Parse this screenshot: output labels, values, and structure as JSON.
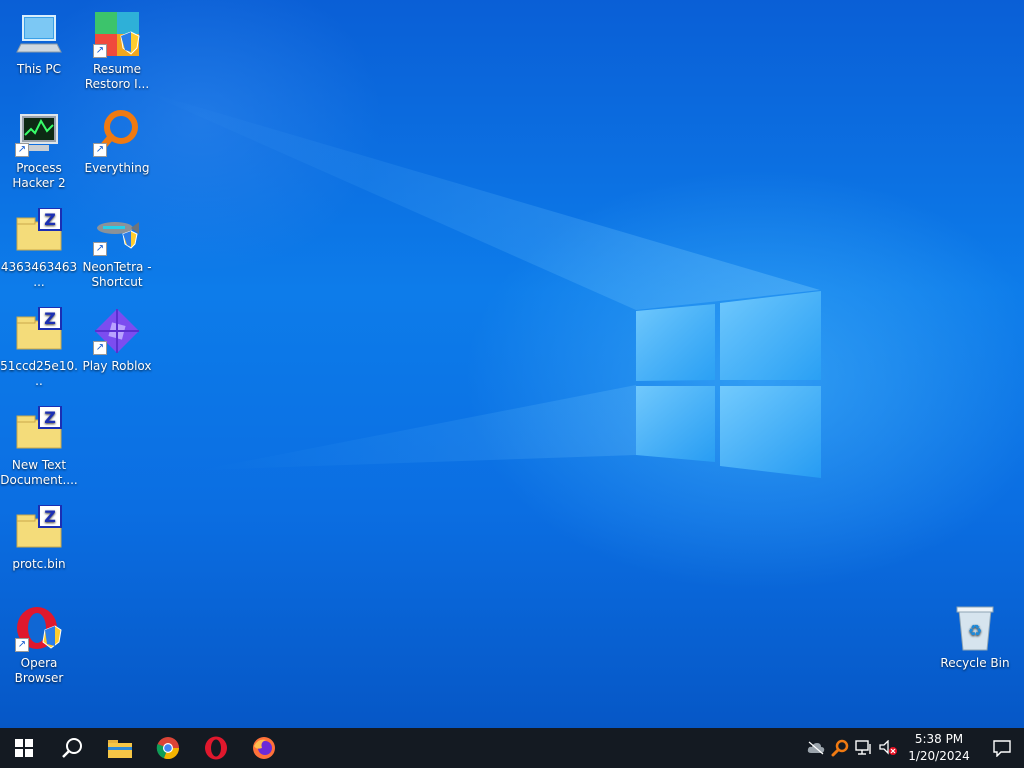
{
  "desktop": {
    "icons": [
      {
        "label": "This PC",
        "icon": "this-pc-icon"
      },
      {
        "label": "Resume Restoro I...",
        "icon": "restoro-icon"
      },
      {
        "label": "Process Hacker 2",
        "icon": "process-hacker-icon"
      },
      {
        "label": "Everything",
        "icon": "everything-search-icon"
      },
      {
        "label": "4363463463...",
        "icon": "zipped-file-icon"
      },
      {
        "label": "NeonTetra - Shortcut",
        "icon": "neontetra-fish-icon"
      },
      {
        "label": "51ccd25e10...",
        "icon": "zipped-file-icon"
      },
      {
        "label": "Play Roblox",
        "icon": "roblox-icon"
      },
      {
        "label": "New Text Document....",
        "icon": "zipped-file-icon"
      },
      {
        "label": "protc.bin",
        "icon": "zipped-file-icon"
      },
      {
        "label": "Opera Browser",
        "icon": "opera-icon"
      },
      {
        "label": "Recycle Bin",
        "icon": "recycle-bin-icon"
      }
    ]
  },
  "taskbar": {
    "pinned": [
      "start-icon",
      "search-icon",
      "file-explorer-icon",
      "chrome-icon",
      "opera-icon",
      "firefox-icon"
    ],
    "tray_icons": [
      "cloud-offline-icon",
      "everything-tray-icon",
      "network-icon",
      "volume-muted-icon"
    ],
    "clock": {
      "time": "5:38 PM",
      "date": "1/20/2024"
    },
    "notification_icon": "notification-icon"
  },
  "colors": {
    "taskbar": "#141a22",
    "wallpaper_accent": "#0b74e8"
  }
}
